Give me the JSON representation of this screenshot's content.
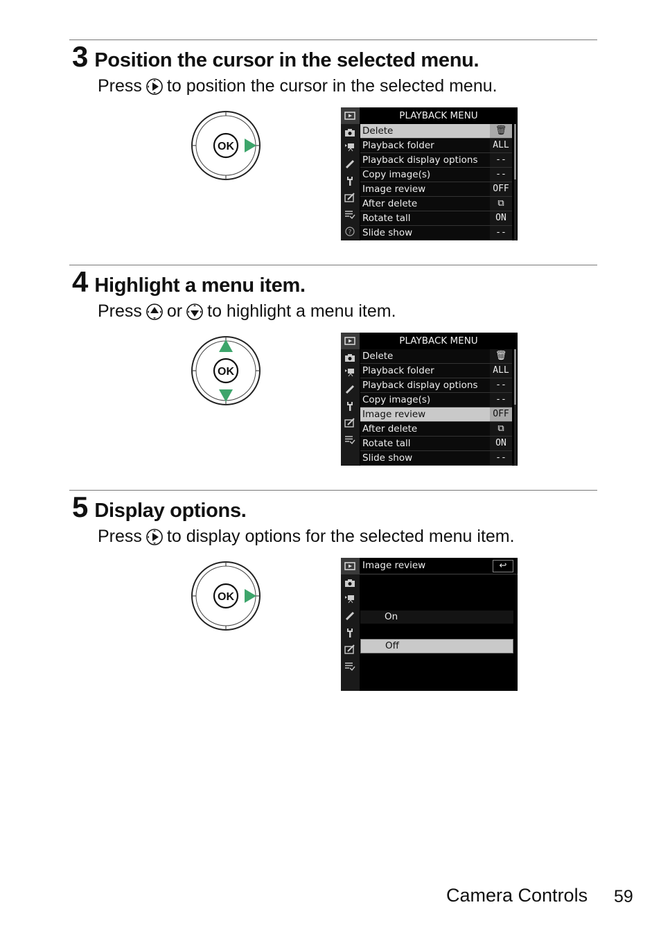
{
  "steps": [
    {
      "number": "3",
      "title": "Position the cursor in the selected menu.",
      "desc_before": "Press",
      "desc_icon": "multi-selector-right-icon",
      "desc_after": "to position the cursor in the selected menu.",
      "dial_highlight": [
        "right"
      ],
      "screen": {
        "type": "menu",
        "title": "PLAYBACK MENU",
        "selected_index": 0,
        "items": [
          {
            "label": "Delete",
            "value": "🗑"
          },
          {
            "label": "Playback folder",
            "value": "ALL"
          },
          {
            "label": "Playback display options",
            "value": "--"
          },
          {
            "label": "Copy image(s)",
            "value": "--"
          },
          {
            "label": "Image review",
            "value": "OFF"
          },
          {
            "label": "After delete",
            "value": "⧉"
          },
          {
            "label": "Rotate tall",
            "value": "ON"
          },
          {
            "label": "Slide show",
            "value": "--"
          }
        ],
        "sidebar_icons": [
          "playback-icon",
          "camera-icon",
          "movie-icon",
          "pencil-icon",
          "wrench-icon",
          "retouch-icon",
          "my-menu-icon",
          "help-icon"
        ]
      }
    },
    {
      "number": "4",
      "title": "Highlight a menu item.",
      "desc_before": "Press",
      "desc_icon": "multi-selector-up-icon",
      "desc_mid": "or",
      "desc_icon2": "multi-selector-down-icon",
      "desc_after": "to highlight a menu item.",
      "dial_highlight": [
        "up",
        "down"
      ],
      "screen": {
        "type": "menu",
        "title": "PLAYBACK MENU",
        "selected_index": 4,
        "items": [
          {
            "label": "Delete",
            "value": "🗑"
          },
          {
            "label": "Playback folder",
            "value": "ALL"
          },
          {
            "label": "Playback display options",
            "value": "--"
          },
          {
            "label": "Copy image(s)",
            "value": "--"
          },
          {
            "label": "Image review",
            "value": "OFF"
          },
          {
            "label": "After delete",
            "value": "⧉"
          },
          {
            "label": "Rotate tall",
            "value": "ON"
          },
          {
            "label": "Slide show",
            "value": "--"
          }
        ],
        "sidebar_icons": [
          "playback-icon",
          "camera-icon",
          "movie-icon",
          "pencil-icon",
          "wrench-icon",
          "retouch-icon",
          "my-menu-icon"
        ]
      }
    },
    {
      "number": "5",
      "title": "Display options.",
      "desc_before": "Press",
      "desc_icon": "multi-selector-right-icon",
      "desc_after": "to display options for the selected menu item.",
      "dial_highlight": [
        "right"
      ],
      "screen": {
        "type": "options",
        "title": "Image review",
        "back_icon": "↩",
        "options": [
          "On",
          "Off"
        ],
        "selected_index": 1,
        "sidebar_icons": [
          "playback-icon",
          "camera-icon",
          "movie-icon",
          "pencil-icon",
          "wrench-icon",
          "retouch-icon",
          "my-menu-icon"
        ]
      }
    }
  ],
  "dial": {
    "center_label": "OK",
    "accent_color": "#3da56b"
  },
  "footer": {
    "section": "Camera Controls",
    "page": "59"
  }
}
